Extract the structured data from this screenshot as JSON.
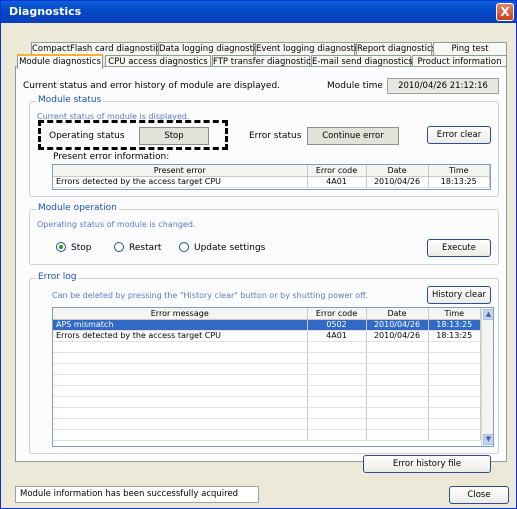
{
  "window": {
    "title": "Diagnostics",
    "close_glyph": "X"
  },
  "tabs_back": [
    "CompactFlash card diagnostics",
    "Data logging diagnostics",
    "Event logging diagnostics",
    "Report diagnostics",
    "Ping test"
  ],
  "tabs_front": [
    "Module diagnostics",
    "CPU access diagnostics",
    "FTP transfer diagnostics",
    "E-mail send diagnostics",
    "Product information"
  ],
  "header": {
    "description": "Current status and error history of module are displayed.",
    "module_time_label": "Module time",
    "module_time_value": "2010/04/26 21:12:16"
  },
  "module_status": {
    "legend": "Module status",
    "note": "Current status of module is displayed.",
    "operating_status_label": "Operating status",
    "operating_status_value": "Stop",
    "error_status_label": "Error status",
    "error_status_value": "Continue error",
    "error_clear": "Error clear",
    "present_error_label": "Present error information:",
    "table": {
      "columns": [
        "Present error",
        "Error code",
        "Date",
        "Time"
      ],
      "rows": [
        [
          "Errors detected by the access target CPU",
          "4A01",
          "2010/04/26",
          "18:13:25"
        ]
      ]
    }
  },
  "module_operation": {
    "legend": "Module operation",
    "note": "Operating status of module is changed.",
    "options": [
      "Stop",
      "Restart",
      "Update settings"
    ],
    "selected": "Stop",
    "execute": "Execute"
  },
  "error_log": {
    "legend": "Error log",
    "note": "Can be deleted by pressing the \"History clear\" button or by shutting power off.",
    "history_clear": "History clear",
    "columns": [
      "Error message",
      "Error code",
      "Date",
      "Time"
    ],
    "rows": [
      [
        "APS mismatch",
        "0502",
        "2010/04/26",
        "18:13:25"
      ],
      [
        "Errors detected by the access target CPU",
        "4A01",
        "2010/04/26",
        "18:13:25"
      ]
    ],
    "error_history_file": "Error history file"
  },
  "footer": {
    "status": "Module information has been successfully acquired",
    "close": "Close"
  }
}
